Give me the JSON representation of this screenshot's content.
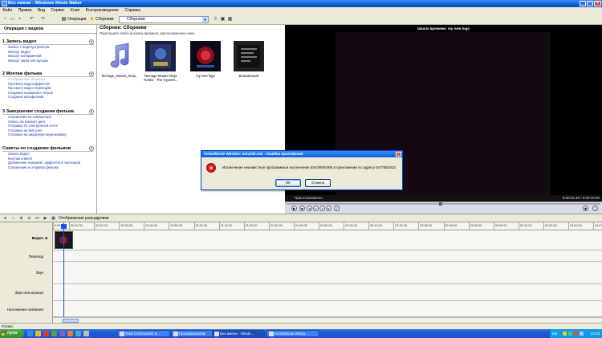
{
  "window": {
    "title": "Без имени - Windows Movie Maker"
  },
  "menu": [
    "Файл",
    "Правка",
    "Вид",
    "Сервис",
    "Клип",
    "Воспроизведение",
    "Справка"
  ],
  "toolbar": {
    "tasks_label": "Операции",
    "collections_label": "Сборники",
    "collection_value": "Сборники"
  },
  "tasks": {
    "header": "Операции с видеом",
    "sections": [
      {
        "number": "1",
        "title": "Запись видео",
        "links": [
          "Запись с видеоустройства",
          "Импорт видео",
          "Импорт изображений",
          "Импорт звука или музыки"
        ]
      },
      {
        "number": "2",
        "title": "Монтаж фильма",
        "links": [
          "Отображение сборника",
          "Просмотр видеоэффектов",
          "Просмотр видео переходов",
          "Создание названий и титров",
          "Создание автофильма"
        ]
      },
      {
        "number": "3",
        "title": "Завершение создания фильма",
        "links": [
          "Сохранение на компьютере",
          "Запись на компакт-диск",
          "Отправка по электронной почте",
          "Отправка на веб-узел",
          "Отправка на цифровую видеокамеру"
        ]
      },
      {
        "number": "",
        "title": "Советы по созданию фильмов",
        "links": [
          "Запись видео",
          "Монтаж клипов",
          "Добавление названий, эффектов и переходов",
          "Сохранение и отправка фильма"
        ]
      }
    ]
  },
  "collection": {
    "title": "Сборник: Сборники",
    "hint": "Перетащите клип на шкалу времени, расположенную ниже.",
    "clips": [
      {
        "caption": "Teenage_Mutant_Ninja...",
        "icon": "music-note-icon"
      },
      {
        "caption": "Teenage Mutant Ninja Turtles - The Hyperst...",
        "icon": "video-thumbnail-icon"
      },
      {
        "caption": "my new logo",
        "icon": "video-thumbnail-icon"
      },
      {
        "caption": "Безымянный",
        "icon": "video-thumbnail-icon"
      }
    ]
  },
  "preview": {
    "title": "Шкала времени: my new logo",
    "status": "Приостановлено",
    "time": "0:00:04.36 / 0:00:10.00"
  },
  "timeline": {
    "label": "Отображение раскадровки",
    "ruler": [
      "0:00",
      "00:10.00",
      "00:20.00",
      "00:30.00",
      "00:40.00",
      "00:50.00",
      "01:00.00",
      "01:10.00",
      "01:20.00",
      "01:30.00",
      "01:40.00",
      "01:50.00",
      "02:00.00",
      "02:10.00",
      "02:20.00",
      "02:30.00",
      "02:40.00",
      "02:50.00",
      "03:00.00",
      "03:10.00",
      "03:20.00",
      "03:30.00",
      "03:40.00"
    ],
    "tracks": [
      "Видео",
      "Переход",
      "Звук",
      "Звук или музыка",
      "Наложение названия"
    ]
  },
  "status": {
    "text": "Готово"
  },
  "taskbar": {
    "start": "пуск",
    "items": [
      "Total Commander 6...",
      "Проигрыватели",
      "Без имени - Windo...",
      "ActiveMovie Windo..."
    ],
    "lang": "EN",
    "clock": "13:18"
  },
  "dialog": {
    "title": "ActiveMovie Window: movmkr.exe - Ошибка приложения",
    "message": "Исключение неизвестное программное исключение (0xc0000409) в приложении по адресу 0x77d6c912.",
    "ok": "OK",
    "cancel": "Отмена"
  }
}
